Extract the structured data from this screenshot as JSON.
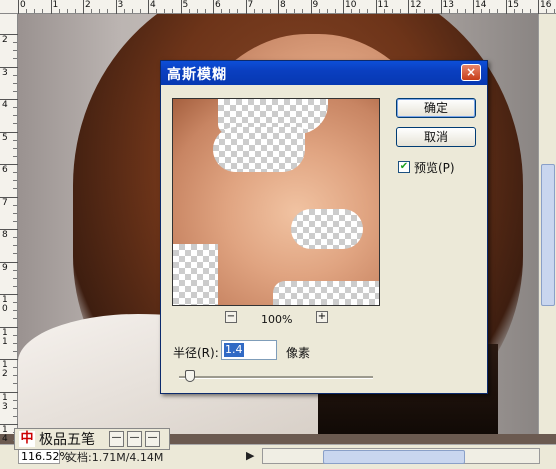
{
  "ruler": {
    "top_numbers": [
      "0",
      "1",
      "2",
      "3",
      "4",
      "5",
      "6",
      "7",
      "8",
      "9",
      "10",
      "11",
      "12",
      "13",
      "14",
      "15",
      "16"
    ],
    "left_numbers": [
      "2",
      "3",
      "4",
      "5",
      "6",
      "7",
      "8",
      "9",
      "10",
      "11",
      "12",
      "13",
      "14"
    ]
  },
  "status_bar": {
    "zoom": "116.52%",
    "doc_info": "文档:1.71M/4.14M",
    "arrow": "▶"
  },
  "ime_toolbar": {
    "logo": "中",
    "name": "极品五笔",
    "btn1": "—",
    "btn2": "—",
    "btn3": "—"
  },
  "dialog": {
    "title": "高斯模糊",
    "close": "×",
    "ok_label": "确定",
    "cancel_label": "取消",
    "preview_checkbox_label": "预览(P)",
    "preview_checked": true,
    "check_mark": "✔",
    "zoom_minus": "−",
    "zoom_plus": "+",
    "zoom_value": "100%",
    "radius_label": "半径(R):",
    "radius_value": "1.4",
    "radius_unit": "像素",
    "slider_fraction": 0.02
  },
  "colors": {
    "titlebar": "#0a3fc0",
    "dialog_bg": "#ece9d8",
    "selection": "#316ac5"
  }
}
